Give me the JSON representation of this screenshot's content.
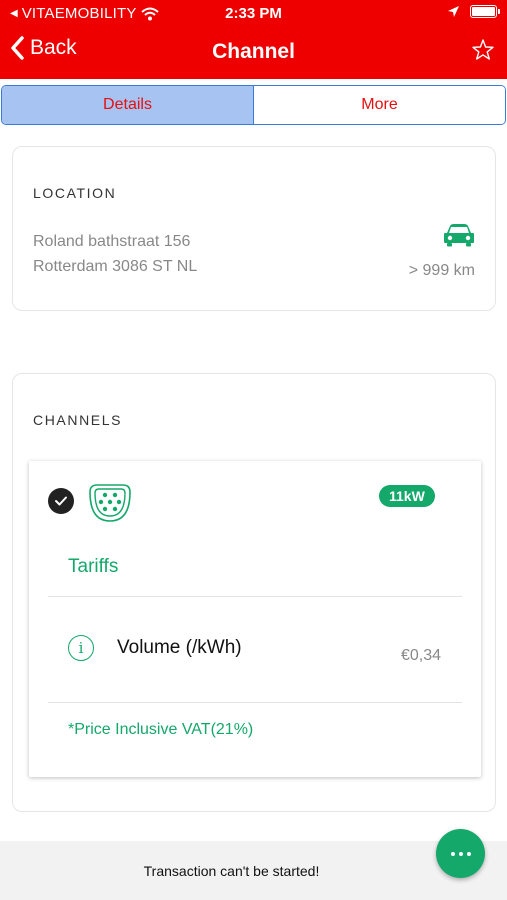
{
  "status_bar": {
    "carrier": "VITAEMOBILITY",
    "time": "2:33 PM"
  },
  "nav": {
    "back_label": "Back",
    "title": "Channel"
  },
  "tabs": [
    {
      "label": "Details",
      "active": true
    },
    {
      "label": "More",
      "active": false
    }
  ],
  "location": {
    "section_title": "LOCATION",
    "address_line1": "Roland bathstraat 156",
    "address_line2": "Rotterdam 3086 ST NL",
    "distance": "> 999 km"
  },
  "channels": {
    "section_title": "CHANNELS",
    "items": [
      {
        "selected": true,
        "power": "11kW",
        "tariffs_label": "Tariffs",
        "tariff_name": "Volume (/kWh)",
        "tariff_price": "€0,34",
        "vat_note": "*Price Inclusive VAT(21%)"
      }
    ]
  },
  "bottom": {
    "message": "Transaction can't be started!"
  },
  "colors": {
    "brand_red": "#ee0000",
    "accent_green": "#14a86a",
    "tab_active_bg": "#a7c3f2",
    "tab_border": "#3a7bd5"
  },
  "icons": [
    "back-chevron-icon",
    "star-icon",
    "car-icon",
    "check-icon",
    "connector-icon",
    "info-icon",
    "more-dots-icon",
    "wifi-icon",
    "location-arrow-icon",
    "battery-icon"
  ]
}
